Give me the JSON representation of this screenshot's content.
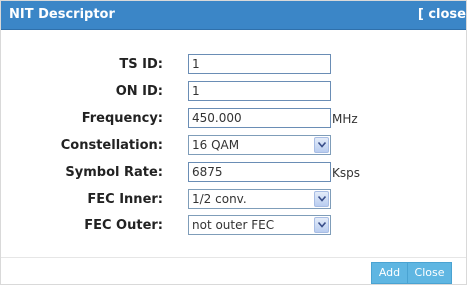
{
  "dialog": {
    "title": "NIT Descriptor",
    "close_link": "[ close"
  },
  "fields": {
    "ts_id": {
      "label": "TS ID:",
      "value": "1"
    },
    "on_id": {
      "label": "ON ID:",
      "value": "1"
    },
    "frequency": {
      "label": "Frequency:",
      "value": "450.000",
      "unit": "MHz"
    },
    "constellation": {
      "label": "Constellation:",
      "value": "16 QAM"
    },
    "symbol_rate": {
      "label": "Symbol Rate:",
      "value": "6875",
      "unit": "Ksps"
    },
    "fec_inner": {
      "label": "FEC Inner:",
      "value": "1/2 conv."
    },
    "fec_outer": {
      "label": "FEC Outer:",
      "value": "not outer FEC"
    }
  },
  "buttons": {
    "add": "Add",
    "close": "Close"
  },
  "colors": {
    "titlebar": "#3b86c7",
    "button": "#5fb6e2",
    "field_border": "#6a8db5"
  },
  "icons": {
    "dropdown": "chevron-down-icon"
  }
}
